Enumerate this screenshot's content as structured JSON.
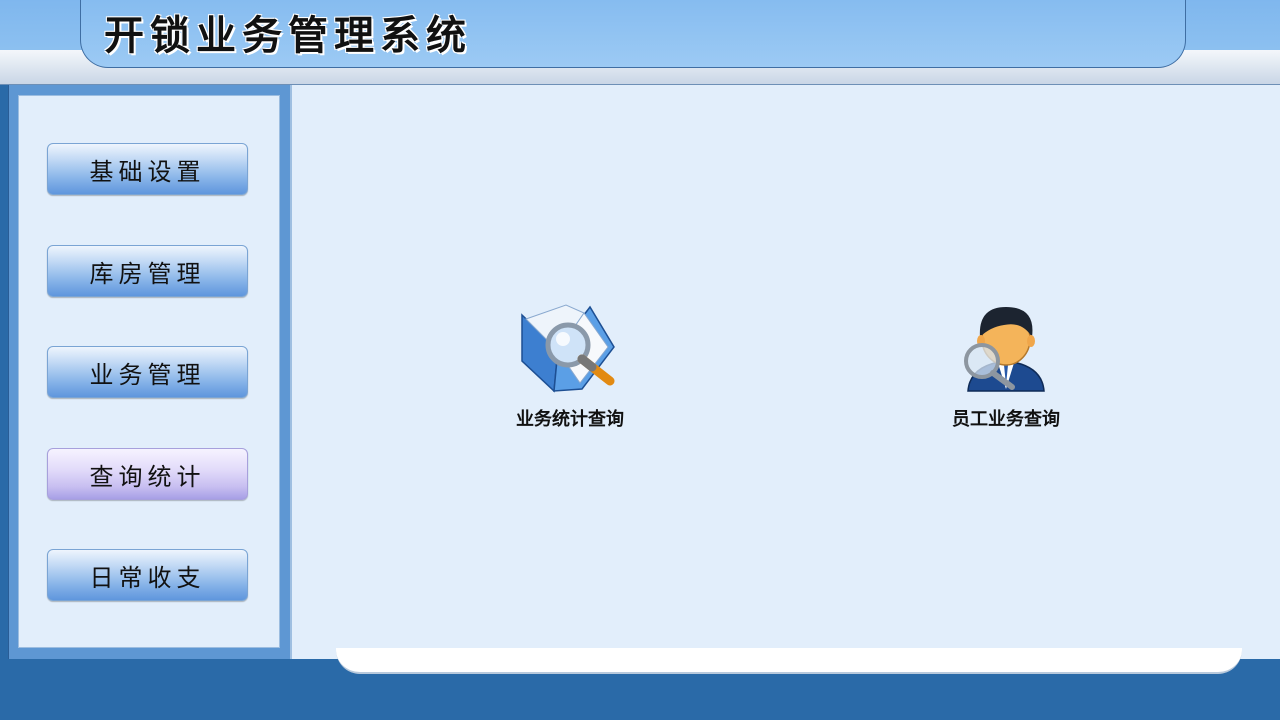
{
  "header": {
    "title": "开锁业务管理系统"
  },
  "sidebar": {
    "items": [
      {
        "label": "基础设置",
        "active": false
      },
      {
        "label": "库房管理",
        "active": false
      },
      {
        "label": "业务管理",
        "active": false
      },
      {
        "label": "查询统计",
        "active": true
      },
      {
        "label": "日常收支",
        "active": false
      }
    ]
  },
  "main": {
    "features": [
      {
        "label": "业务统计查询",
        "icon": "book-magnifier-icon"
      },
      {
        "label": "员工业务查询",
        "icon": "employee-search-icon"
      }
    ]
  },
  "colors": {
    "header": "#8cc0f0",
    "panel": "#e2eefb",
    "frame": "#2a6aa8",
    "button": "#86b3e8",
    "button_active": "#c8bff1"
  }
}
